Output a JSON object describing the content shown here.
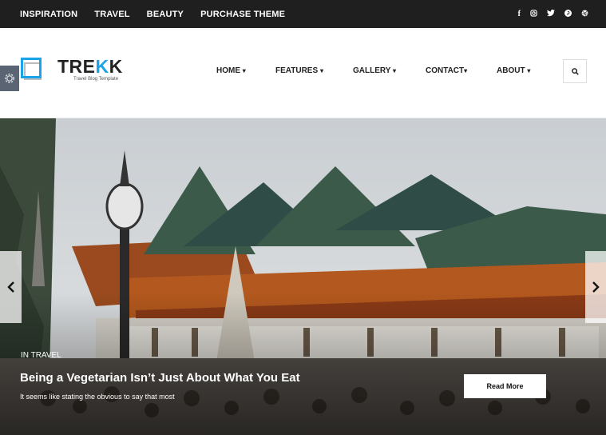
{
  "topbar": {
    "links": [
      "INSPIRATION",
      "TRAVEL",
      "BEAUTY",
      "PURCHASE THEME"
    ],
    "social": [
      {
        "icon": "facebook-icon",
        "glyph": "f"
      },
      {
        "icon": "instagram-icon",
        "glyph": "◎"
      },
      {
        "icon": "twitter-icon",
        "glyph": "🐦"
      },
      {
        "icon": "pinterest-icon",
        "glyph": "●"
      },
      {
        "icon": "dribbble-icon",
        "glyph": "⊛"
      }
    ]
  },
  "logo": {
    "brand_pre": "TRE",
    "brand_accent": "K",
    "brand_post": "K",
    "tagline": "Travel Blog Template",
    "accent_color": "#1aa3e8"
  },
  "nav": {
    "items": [
      {
        "label": "HOME",
        "caret": "▾"
      },
      {
        "label": "FEATURES",
        "caret": "▾"
      },
      {
        "label": "GALLERY",
        "caret": "▾"
      },
      {
        "label": "CONTACT",
        "caret": "▾"
      },
      {
        "label": "ABOUT",
        "caret": "▾"
      }
    ]
  },
  "hero": {
    "category": "IN TRAVEL",
    "title": "Being a Vegetarian Isn’t Just About What You Eat",
    "excerpt": "It seems like stating the obvious to say that most",
    "button": "Read More"
  }
}
